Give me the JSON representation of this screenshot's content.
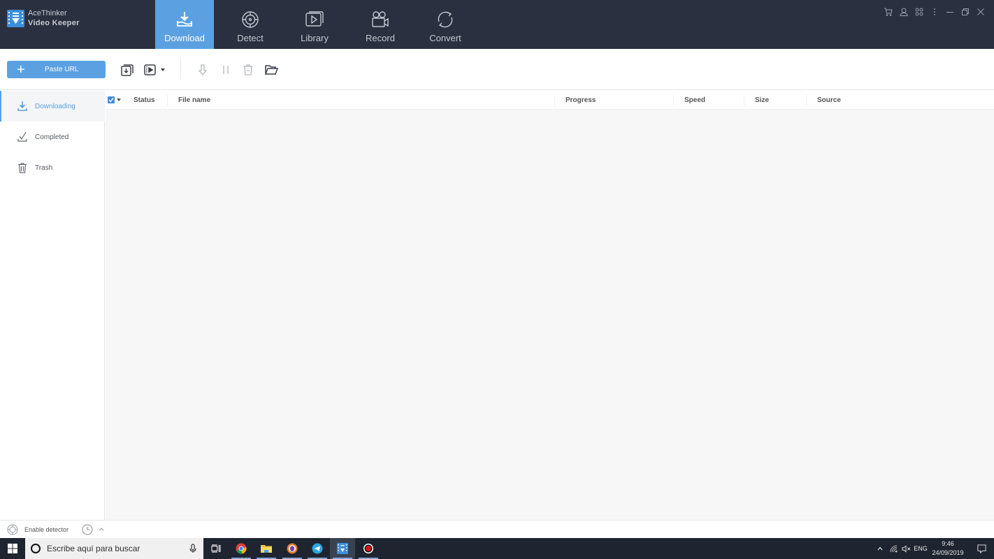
{
  "app": {
    "brand_line1": "AceThinker",
    "brand_line2": "Video Keeper",
    "logo_icon": "filmstrip-download-icon",
    "accent_color": "#5ba1e2",
    "titlebar_color": "#2b3040"
  },
  "nav": {
    "tabs": [
      {
        "label": "Download",
        "icon": "download-tray-icon",
        "active": true
      },
      {
        "label": "Detect",
        "icon": "target-icon",
        "active": false
      },
      {
        "label": "Library",
        "icon": "video-library-icon",
        "active": false
      },
      {
        "label": "Record",
        "icon": "video-camera-icon",
        "active": false
      },
      {
        "label": "Convert",
        "icon": "convert-arrows-icon",
        "active": false
      }
    ]
  },
  "window_controls": [
    "cart-icon",
    "user-icon",
    "apps-icon",
    "more-vertical-icon",
    "minimize-icon",
    "restore-icon",
    "close-icon"
  ],
  "toolbar": {
    "paste_url_label": "Paste URL",
    "icons": [
      "download-from-list-icon",
      "video-convert-icon",
      "resume-icon",
      "pause-icon",
      "delete-icon",
      "open-folder-icon"
    ]
  },
  "sidebar": {
    "items": [
      {
        "label": "Downloading",
        "icon": "download-icon",
        "active": true
      },
      {
        "label": "Completed",
        "icon": "check-icon",
        "active": false
      },
      {
        "label": "Trash",
        "icon": "trash-icon",
        "active": false
      }
    ]
  },
  "table": {
    "select_all_checked": true,
    "columns": [
      "Status",
      "File name",
      "Progress",
      "Speed",
      "Size",
      "Source"
    ],
    "rows": []
  },
  "statusbar": {
    "detector_label": "Enable detector"
  },
  "taskbar": {
    "search_placeholder": "Escribe aquí para buscar",
    "apps": [
      "task-view-icon",
      "chrome-icon",
      "file-explorer-icon",
      "brave-icon",
      "telegram-icon",
      "video-keeper-icon",
      "recorder-icon"
    ],
    "language": "ENG",
    "time": "9:46",
    "date": "24/09/2019"
  }
}
